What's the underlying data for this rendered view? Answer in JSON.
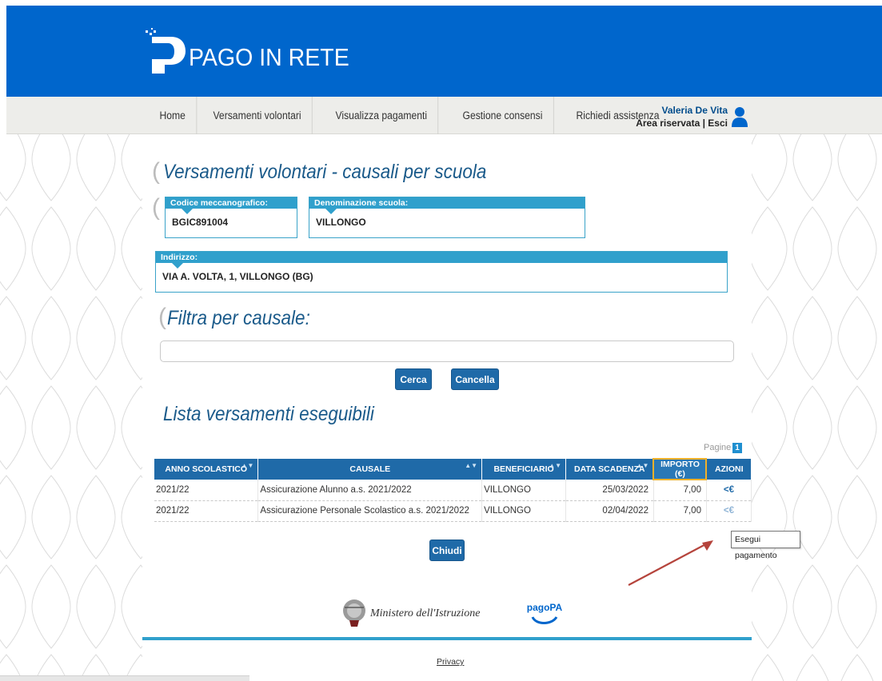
{
  "app": {
    "brand": "PAGO IN RETE"
  },
  "nav": {
    "items": [
      {
        "label": "Home"
      },
      {
        "label": "Versamenti volontari"
      },
      {
        "label": "Visualizza pagamenti"
      },
      {
        "label": "Gestione consensi"
      },
      {
        "label": "Richiedi assistenza"
      }
    ],
    "user_name": "Valeria De Vita",
    "area_label": "Area riservata | Esci"
  },
  "page": {
    "title": "Versamenti volontari - causali per scuola",
    "codice_label": "Codice meccanografico:",
    "codice_value": "BGIC891004",
    "denominazione_label": "Denominazione scuola:",
    "denominazione_value": "VILLONGO",
    "indirizzo_label": "Indirizzo:",
    "indirizzo_value": "VIA A. VOLTA, 1, VILLONGO (BG)",
    "filter_title": "Filtra per causale:",
    "filter_value": "",
    "cerca_label": "Cerca",
    "cancella_label": "Cancella",
    "list_title": "Lista versamenti eseguibili",
    "pages_label": "Pagine",
    "current_page": "1",
    "chiudi_label": "Chiudi",
    "tooltip": "Esegui pagamento",
    "ministero_text": "Ministero dell'Istruzione",
    "pagopa_text": "pagoPA",
    "privacy_label": "Privacy"
  },
  "table": {
    "headers": [
      "ANNO SCOLASTICO",
      "CAUSALE",
      "BENEFICIARIO",
      "DATA SCADENZA",
      "IMPORTO (€)",
      "AZIONI"
    ],
    "rows": [
      {
        "anno": "2021/22",
        "causale": "Assicurazione Alunno a.s. 2021/2022",
        "beneficiario": "VILLONGO",
        "scadenza": "25/03/2022",
        "importo": "7,00",
        "azione": "<€"
      },
      {
        "anno": "2021/22",
        "causale": "Assicurazione Personale Scolastico a.s. 2021/2022",
        "beneficiario": "VILLONGO",
        "scadenza": "02/04/2022",
        "importo": "7,00",
        "azione": "<€"
      }
    ]
  },
  "colors": {
    "header_blue": "#0066cc",
    "accent_blue": "#30a0cc",
    "button_blue": "#1f6aa8",
    "arrow_red": "#b5443c"
  },
  "icons": {
    "logo": "pagoinrete-logo-icon",
    "user": "user-icon",
    "sort": "sort-icon",
    "pay": "pay-icon",
    "arrow": "annotation-arrow"
  }
}
